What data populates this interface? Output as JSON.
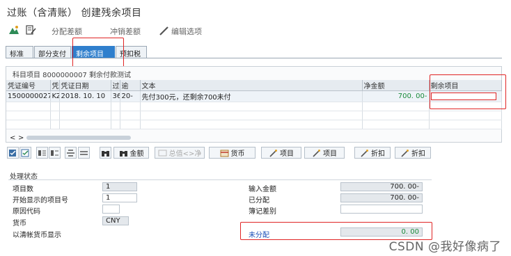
{
  "title": "过账（含清账） 创建残余项目",
  "toolbar": {
    "distribute_diff": "分配差额",
    "writeoff_diff": "冲销差额",
    "edit_options": "编辑选项"
  },
  "tabs": [
    "标准",
    "部分支付",
    "剩余项目",
    "预扣税"
  ],
  "panel_title": "科目项目 8000000007 剩余付款测试",
  "grid": {
    "headers": [
      "凭证编号",
      "凭",
      "凭证日期",
      "过",
      "逾",
      "文本",
      "净金额",
      "剩余项目"
    ],
    "rows": [
      [
        "1500000027",
        "KZ",
        "2018. 10. 10",
        "36",
        "20-",
        "先付300元，还剩余700未付",
        "700. 00-",
        ""
      ]
    ]
  },
  "scroll": {
    "left": "<",
    "right": ">"
  },
  "buttons": {
    "currency": "货币",
    "amount": "金额",
    "gross_net": "总值<>净",
    "items1": "项目",
    "items2": "项目",
    "discount1": "折扣",
    "discount2": "折扣"
  },
  "status": {
    "title": "处理状态",
    "left": [
      {
        "label": "项目数",
        "value": "1"
      },
      {
        "label": "开始显示的项目号",
        "value": "1"
      },
      {
        "label": "原因代码",
        "value": ""
      },
      {
        "label": "货币",
        "value": "CNY"
      },
      {
        "label": "以清帐货币显示",
        "value": ""
      }
    ],
    "right": [
      {
        "label": "输入金额",
        "value": "700. 00-"
      },
      {
        "label": "已分配",
        "value": "700. 00-"
      },
      {
        "label": "簿记差别",
        "value": ""
      },
      {
        "label": "未分配",
        "value": "0. 00"
      }
    ]
  },
  "watermark": "CSDN @我好像病了",
  "colors": {
    "accent": "#2f7fcd",
    "highlight": "#e02424",
    "positive": "#1a8a3a"
  }
}
